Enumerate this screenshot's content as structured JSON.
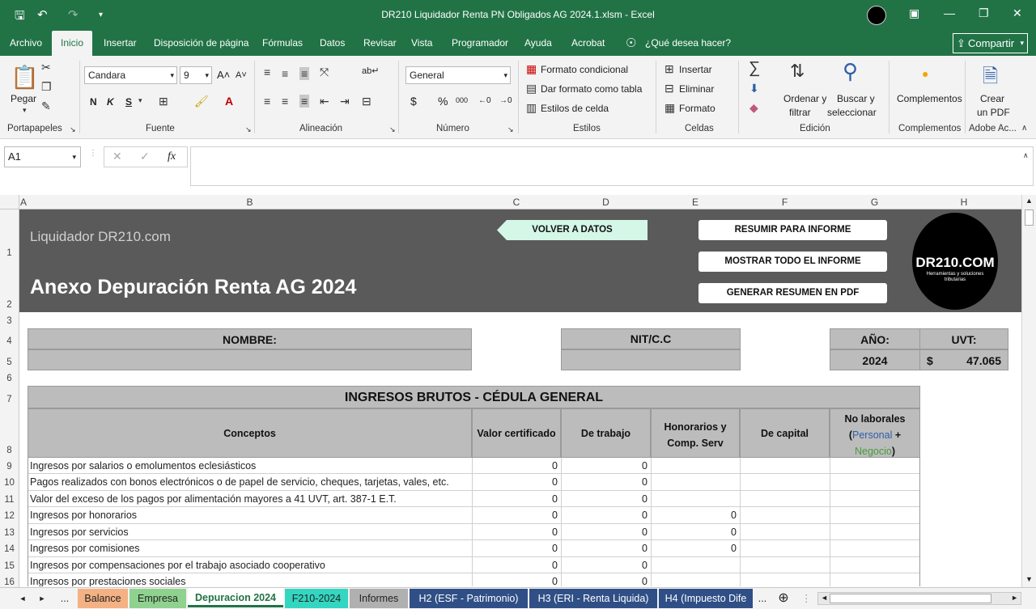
{
  "window": {
    "title": "DR210 Liquidador Renta PN Obligados AG 2024.1.xlsm  -  Excel"
  },
  "ribbon_tabs": [
    "Archivo",
    "Inicio",
    "Insertar",
    "Disposición de página",
    "Fórmulas",
    "Datos",
    "Revisar",
    "Vista",
    "Programador",
    "Ayuda",
    "Acrobat",
    "¿Qué desea hacer?"
  ],
  "share_label": "Compartir",
  "ribbon": {
    "paste": "Pegar",
    "font_name": "Candara",
    "font_size": "9",
    "bold": "N",
    "italic": "K",
    "underline": "S",
    "number_format": "General",
    "cond_format": "Formato condicional",
    "table_format": "Dar formato como tabla",
    "cell_styles": "Estilos de celda",
    "insert": "Insertar",
    "delete": "Eliminar",
    "format": "Formato",
    "sort": "Ordenar y",
    "sort2": "filtrar",
    "find": "Buscar y",
    "find2": "seleccionar",
    "addins": "Complementos",
    "create_pdf": "Crear",
    "create_pdf2": "un PDF",
    "groups": {
      "clipboard": "Portapapeles",
      "font": "Fuente",
      "alignment": "Alineación",
      "number": "Número",
      "styles": "Estilos",
      "cells": "Celdas",
      "editing": "Edición",
      "addins": "Complementos",
      "adobe": "Adobe Ac..."
    }
  },
  "formula_bar": {
    "name_box": "A1",
    "fx": "fx",
    "value": ""
  },
  "columns": [
    "A",
    "B",
    "C",
    "D",
    "E",
    "F",
    "G",
    "H"
  ],
  "rows": [
    "1",
    "2",
    "3",
    "4",
    "5",
    "6",
    "7",
    "8",
    "9",
    "10",
    "11",
    "12",
    "13",
    "14",
    "15",
    "16"
  ],
  "sheet": {
    "brand": "Liquidador DR210.com",
    "heading": "Anexo Depuración Renta AG 2024",
    "volver": "VOLVER A DATOS",
    "resumir": "RESUMIR PARA INFORME",
    "mostrar": "MOSTRAR TODO EL INFORME",
    "generar": "GENERAR RESUMEN EN PDF",
    "logo_text": "DR210.COM",
    "logo_sub": "Herramientas y soluciones tributarias",
    "nombre_label": "NOMBRE:",
    "nit_label": "NIT/C.C",
    "anio_label": "AÑO:",
    "uvt_label": "UVT:",
    "anio_value": "2024",
    "uvt_currency": "$",
    "uvt_value": "47.065",
    "section_title": "INGRESOS BRUTOS - CÉDULA GENERAL",
    "headers": {
      "conceptos": "Conceptos",
      "valor_cert": "Valor certificado",
      "trabajo": "De trabajo",
      "honorarios": "Honorarios y",
      "honorarios2": "Comp. Serv",
      "capital": "De capital",
      "no_laborales": "No laborales",
      "paren_open": "(",
      "personal": "Personal",
      "plus": " +",
      "negocio": "Negocio",
      "paren_close": ")"
    },
    "table_rows": [
      {
        "concept": "Ingresos por salarios o emolumentos eclesiásticos",
        "c": "0",
        "d": "0",
        "e": ""
      },
      {
        "concept": "Pagos realizados con bonos electrónicos o de papel de servicio, cheques, tarjetas, vales, etc.",
        "c": "0",
        "d": "0",
        "e": ""
      },
      {
        "concept": "Valor del exceso de los pagos por alimentación mayores a 41 UVT, art. 387-1 E.T.",
        "c": "0",
        "d": "0",
        "e": ""
      },
      {
        "concept": "Ingresos por honorarios",
        "c": "0",
        "d": "0",
        "e": "0"
      },
      {
        "concept": "Ingresos por servicios",
        "c": "0",
        "d": "0",
        "e": "0"
      },
      {
        "concept": "Ingresos por comisiones",
        "c": "0",
        "d": "0",
        "e": "0"
      },
      {
        "concept": "Ingresos por compensaciones por el trabajo asociado cooperativo",
        "c": "0",
        "d": "0",
        "e": ""
      },
      {
        "concept": "Ingresos por prestaciones sociales",
        "c": "0",
        "d": "0",
        "e": ""
      }
    ],
    "colors": {
      "personal": "#2e5fa8",
      "negocio": "#4a9a3a",
      "volver_bg": "#d4f7e8"
    }
  },
  "sheet_tabs": [
    {
      "label": "...",
      "bg": "#f3f3f3"
    },
    {
      "label": "Balance",
      "bg": "#f4b183"
    },
    {
      "label": "Empresa",
      "bg": "#8fd18f"
    },
    {
      "label": "Depuracion 2024",
      "bg": "#ffffff"
    },
    {
      "label": "F210-2024",
      "bg": "#33d6c0"
    },
    {
      "label": "Informes",
      "bg": "#b0b0b0"
    },
    {
      "label": "H2 (ESF - Patrimonio)",
      "bg": "#2f4f86"
    },
    {
      "label": "H3 (ERI - Renta Liquida)",
      "bg": "#2f4f86"
    },
    {
      "label": "H4 (Impuesto Dife",
      "bg": "#2f4f86"
    },
    {
      "label": "...",
      "bg": "#f3f3f3"
    }
  ]
}
